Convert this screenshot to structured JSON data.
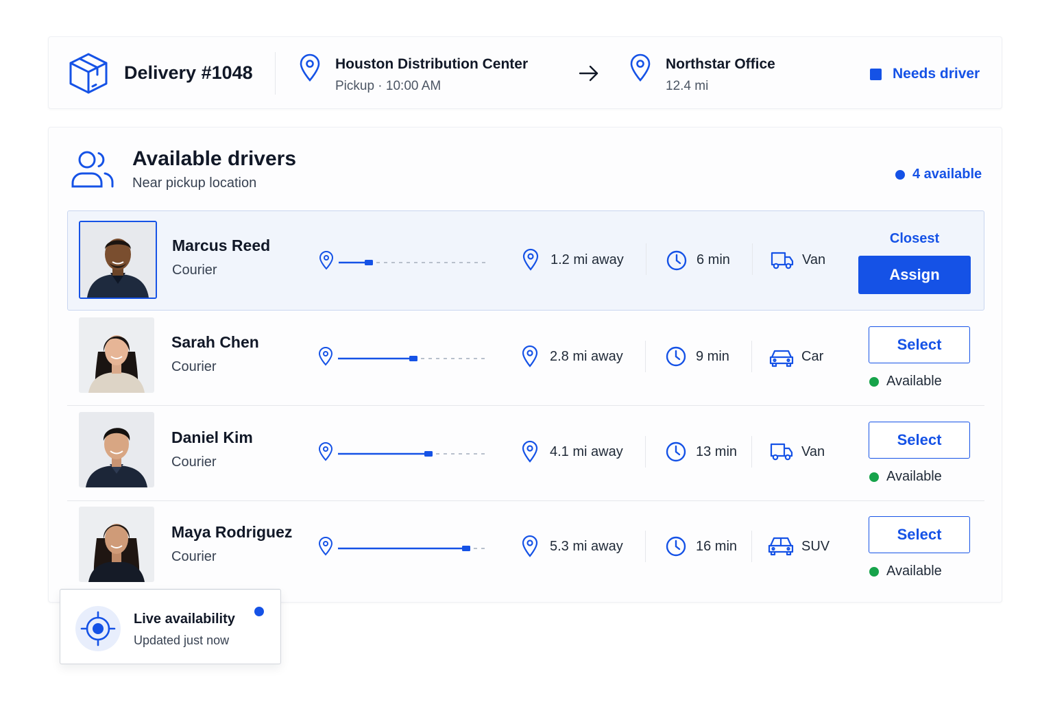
{
  "delivery": {
    "title": "Delivery #1048",
    "pickup": {
      "name": "Houston Distribution Center",
      "detail": "Pickup · 10:00 AM"
    },
    "dropoff": {
      "name": "Northstar Office",
      "detail": "12.4 mi"
    },
    "status": "Needs driver"
  },
  "drivers_panel": {
    "title": "Available drivers",
    "subtitle": "Near pickup location",
    "available_count": "4 available",
    "drivers": [
      {
        "name": "Marcus Reed",
        "role": "Courier",
        "distance": "1.2 mi away",
        "eta": "6 min",
        "vehicle": "Van",
        "vehicle_icon": "van-icon",
        "proximity": 0.2,
        "tag": "Closest",
        "action": "Assign"
      },
      {
        "name": "Sarah Chen",
        "role": "Courier",
        "distance": "2.8 mi away",
        "eta": "9 min",
        "vehicle": "Car",
        "vehicle_icon": "car-icon",
        "proximity": 0.5,
        "action": "Select",
        "status": "Available"
      },
      {
        "name": "Daniel Kim",
        "role": "Courier",
        "distance": "4.1 mi away",
        "eta": "13 min",
        "vehicle": "Van",
        "vehicle_icon": "van-icon",
        "proximity": 0.6,
        "action": "Select",
        "status": "Available"
      },
      {
        "name": "Maya Rodriguez",
        "role": "Courier",
        "distance": "5.3 mi away",
        "eta": "16 min",
        "vehicle": "SUV",
        "vehicle_icon": "suv-icon",
        "proximity": 0.85,
        "action": "Select",
        "status": "Available"
      }
    ]
  },
  "live": {
    "title": "Live availability",
    "subtitle": "Updated just now"
  },
  "colors": {
    "accent": "#1552e6",
    "available": "#16a34a",
    "highlight_row": "#f1f5fc"
  }
}
